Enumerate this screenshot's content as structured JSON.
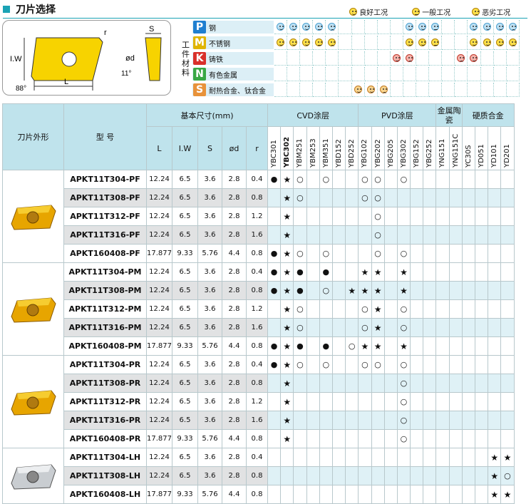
{
  "title": "刀片选择",
  "legend": {
    "good": "良好工况",
    "normal": "一般工况",
    "bad": "恶劣工况"
  },
  "diagram": {
    "r": "r",
    "iw": "I.W",
    "l": "L",
    "s": "S",
    "d": "ød",
    "a11": "11°",
    "a88": "88°"
  },
  "materials": {
    "group_label": "工件材料",
    "rows": [
      {
        "code": "P",
        "name": "钢",
        "color": "#1f7fd0",
        "cells": [
          "b1",
          "b1",
          "b1",
          "b0",
          "b2",
          "",
          "",
          "",
          "",
          "",
          "b1",
          "b1",
          "b0",
          "",
          "",
          "b1",
          "b1",
          "b1",
          "b2"
        ]
      },
      {
        "code": "M",
        "name": "不锈钢",
        "color": "#e0b400",
        "cells": [
          "y1",
          "y1",
          "y1",
          "y0",
          "y2",
          "",
          "",
          "",
          "",
          "",
          "y1",
          "y1",
          "y0",
          "",
          "",
          "y1",
          "y1",
          "y1",
          "y2"
        ]
      },
      {
        "code": "K",
        "name": "铸铁",
        "color": "#d9302a",
        "cells": [
          "",
          "",
          "",
          "",
          "",
          "",
          "",
          "",
          "",
          "r1",
          "r2",
          "",
          "",
          "",
          "r2",
          "r1",
          "",
          "",
          "",
          "",
          "",
          "",
          "r2",
          "",
          "r2"
        ]
      },
      {
        "code": "N",
        "name": "有色金属",
        "color": "#39a845",
        "cells": [
          "",
          "",
          "",
          "",
          "",
          "",
          "",
          "",
          "",
          "",
          "",
          "",
          "",
          "",
          "",
          "",
          "",
          "",
          "",
          "",
          "",
          "",
          "",
          "g1",
          "g2"
        ]
      },
      {
        "code": "S",
        "name": "耐热合金、钛合金",
        "color": "#e8923a",
        "cells": [
          "",
          "",
          "",
          "",
          "",
          "",
          "o1",
          "o1",
          "o2"
        ]
      }
    ]
  },
  "table": {
    "h_shape": "刀片外形",
    "h_model": "型  号",
    "h_dims": "基本尺寸(mm)",
    "dims": [
      "L",
      "I.W",
      "S",
      "ød",
      "r"
    ],
    "groups": [
      "CVD涂层",
      "PVD涂层",
      "金属陶瓷",
      "硬质合金"
    ],
    "grades": [
      "YBC301",
      "YBC302",
      "YBM251",
      "YBM253",
      "YBM351",
      "YBD152",
      "YBD252",
      "YBG102",
      "YBG202",
      "YBG205",
      "YBG302",
      "YBG152",
      "YBG252",
      "YNG151",
      "YNG151C",
      "YC30S",
      "YD051",
      "YD101",
      "YD201"
    ],
    "rows": [
      {
        "m": "APKT11T304-PF",
        "d": [
          "12.24",
          "6.5",
          "3.6",
          "2.8",
          "0.4"
        ],
        "g": [
          "●",
          "★",
          "○",
          "",
          "○",
          "",
          "",
          "○",
          "○",
          "",
          "○",
          "",
          "",
          "",
          "",
          "",
          "",
          "",
          ""
        ]
      },
      {
        "m": "APKT11T308-PF",
        "d": [
          "12.24",
          "6.5",
          "3.6",
          "2.8",
          "0.8"
        ],
        "g": [
          "",
          "★",
          "○",
          "",
          "",
          "",
          "",
          "○",
          "○",
          "",
          "",
          "",
          "",
          "",
          "",
          "",
          "",
          "",
          ""
        ]
      },
      {
        "m": "APKT11T312-PF",
        "d": [
          "12.24",
          "6.5",
          "3.6",
          "2.8",
          "1.2"
        ],
        "g": [
          "",
          "★",
          "",
          "",
          "",
          "",
          "",
          "",
          "○",
          "",
          "",
          "",
          "",
          "",
          "",
          "",
          "",
          "",
          ""
        ]
      },
      {
        "m": "APKT11T316-PF",
        "d": [
          "12.24",
          "6.5",
          "3.6",
          "2.8",
          "1.6"
        ],
        "g": [
          "",
          "★",
          "",
          "",
          "",
          "",
          "",
          "",
          "○",
          "",
          "",
          "",
          "",
          "",
          "",
          "",
          "",
          "",
          ""
        ]
      },
      {
        "m": "APKT160408-PF",
        "d": [
          "17.877",
          "9.33",
          "5.76",
          "4.4",
          "0.8"
        ],
        "g": [
          "●",
          "★",
          "○",
          "",
          "○",
          "",
          "",
          "",
          "○",
          "",
          "○",
          "",
          "",
          "",
          "",
          "",
          "",
          "",
          ""
        ]
      },
      {
        "m": "APKT11T304-PM",
        "d": [
          "12.24",
          "6.5",
          "3.6",
          "2.8",
          "0.4"
        ],
        "g": [
          "●",
          "★",
          "●",
          "",
          "●",
          "",
          "",
          "★",
          "★",
          "",
          "★",
          "",
          "",
          "",
          "",
          "",
          "",
          "",
          ""
        ]
      },
      {
        "m": "APKT11T308-PM",
        "d": [
          "12.24",
          "6.5",
          "3.6",
          "2.8",
          "0.8"
        ],
        "g": [
          "●",
          "★",
          "●",
          "",
          "○",
          "",
          "★",
          "★",
          "★",
          "",
          "★",
          "",
          "",
          "",
          "",
          "",
          "",
          "",
          ""
        ]
      },
      {
        "m": "APKT11T312-PM",
        "d": [
          "12.24",
          "6.5",
          "3.6",
          "2.8",
          "1.2"
        ],
        "g": [
          "",
          "★",
          "○",
          "",
          "",
          "",
          "",
          "○",
          "★",
          "",
          "○",
          "",
          "",
          "",
          "",
          "",
          "",
          "",
          ""
        ]
      },
      {
        "m": "APKT11T316-PM",
        "d": [
          "12.24",
          "6.5",
          "3.6",
          "2.8",
          "1.6"
        ],
        "g": [
          "",
          "★",
          "○",
          "",
          "",
          "",
          "",
          "○",
          "★",
          "",
          "○",
          "",
          "",
          "",
          "",
          "",
          "",
          "",
          ""
        ]
      },
      {
        "m": "APKT160408-PM",
        "d": [
          "17.877",
          "9.33",
          "5.76",
          "4.4",
          "0.8"
        ],
        "g": [
          "●",
          "★",
          "●",
          "",
          "●",
          "",
          "○",
          "★",
          "★",
          "",
          "★",
          "",
          "",
          "",
          "",
          "",
          "",
          "",
          ""
        ]
      },
      {
        "m": "APKT11T304-PR",
        "d": [
          "12.24",
          "6.5",
          "3.6",
          "2.8",
          "0.4"
        ],
        "g": [
          "●",
          "★",
          "○",
          "",
          "○",
          "",
          "",
          "○",
          "○",
          "",
          "○",
          "",
          "",
          "",
          "",
          "",
          "",
          "",
          ""
        ]
      },
      {
        "m": "APKT11T308-PR",
        "d": [
          "12.24",
          "6.5",
          "3.6",
          "2.8",
          "0.8"
        ],
        "g": [
          "",
          "★",
          "",
          "",
          "",
          "",
          "",
          "",
          "",
          "",
          "○",
          "",
          "",
          "",
          "",
          "",
          "",
          "",
          ""
        ]
      },
      {
        "m": "APKT11T312-PR",
        "d": [
          "12.24",
          "6.5",
          "3.6",
          "2.8",
          "1.2"
        ],
        "g": [
          "",
          "★",
          "",
          "",
          "",
          "",
          "",
          "",
          "",
          "",
          "○",
          "",
          "",
          "",
          "",
          "",
          "",
          "",
          ""
        ]
      },
      {
        "m": "APKT11T316-PR",
        "d": [
          "12.24",
          "6.5",
          "3.6",
          "2.8",
          "1.6"
        ],
        "g": [
          "",
          "★",
          "",
          "",
          "",
          "",
          "",
          "",
          "",
          "",
          "○",
          "",
          "",
          "",
          "",
          "",
          "",
          "",
          ""
        ]
      },
      {
        "m": "APKT160408-PR",
        "d": [
          "17.877",
          "9.33",
          "5.76",
          "4.4",
          "0.8"
        ],
        "g": [
          "",
          "★",
          "",
          "",
          "",
          "",
          "",
          "",
          "",
          "",
          "○",
          "",
          "",
          "",
          "",
          "",
          "",
          "",
          ""
        ]
      },
      {
        "m": "APKT11T304-LH",
        "d": [
          "12.24",
          "6.5",
          "3.6",
          "2.8",
          "0.4"
        ],
        "g": [
          "",
          "",
          "",
          "",
          "",
          "",
          "",
          "",
          "",
          "",
          "",
          "",
          "",
          "",
          "",
          "",
          "",
          "★",
          "★"
        ]
      },
      {
        "m": "APKT11T308-LH",
        "d": [
          "12.24",
          "6.5",
          "3.6",
          "2.8",
          "0.8"
        ],
        "g": [
          "",
          "",
          "",
          "",
          "",
          "",
          "",
          "",
          "",
          "",
          "",
          "",
          "",
          "",
          "",
          "",
          "",
          "★",
          "○"
        ]
      },
      {
        "m": "APKT160408-LH",
        "d": [
          "17.877",
          "9.33",
          "5.76",
          "4.4",
          "0.8"
        ],
        "g": [
          "",
          "",
          "",
          "",
          "",
          "",
          "",
          "",
          "",
          "",
          "",
          "",
          "",
          "",
          "",
          "",
          "",
          "★",
          "★"
        ]
      }
    ]
  }
}
